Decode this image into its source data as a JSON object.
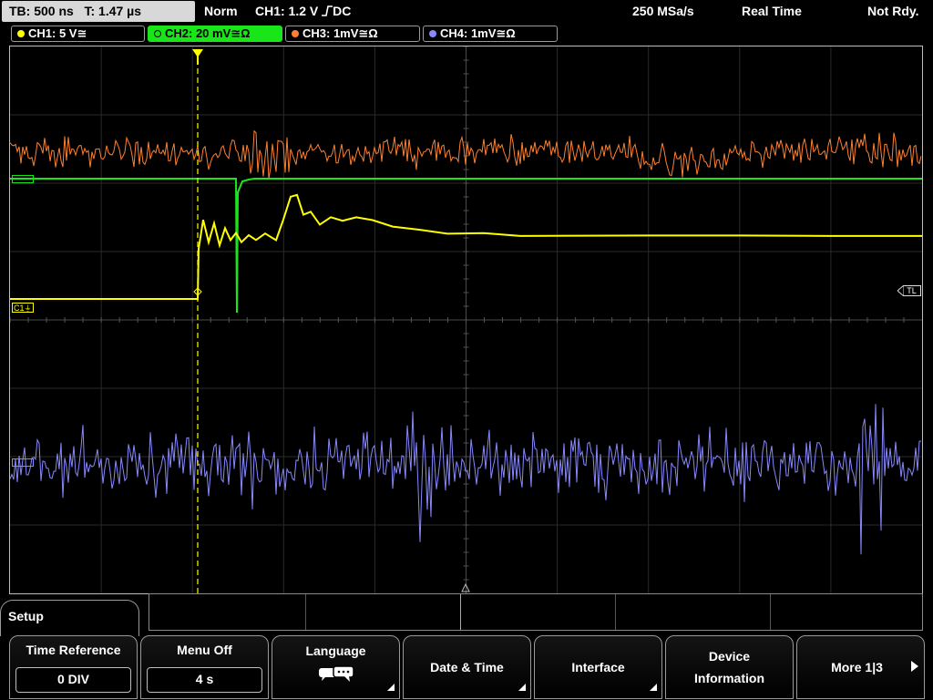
{
  "topbar": {
    "timebase": "TB: 500 ns",
    "trigger_time": "T: 1.47 µs",
    "trigger_mode": "Norm",
    "trigger_source": "CH1: 1.2 V",
    "trigger_coupling": "DC",
    "sample_rate": "250 MSa/s",
    "acq_mode": "Real Time",
    "status": "Not Rdy."
  },
  "channels": [
    {
      "label": "CH1: 5 V≅",
      "color": "#ffff00"
    },
    {
      "label": "CH2: 20 mV≅Ω",
      "color": "#19e619"
    },
    {
      "label": "CH3: 1mV≅Ω",
      "color": "#ff8030"
    },
    {
      "label": "CH4: 1mV≅Ω",
      "color": "#8888ff"
    }
  ],
  "markers": {
    "c1": "C1",
    "tl": "TL"
  },
  "menu": {
    "title": "Setup",
    "softkeys": [
      {
        "label": "Time Reference",
        "value": "0 DIV"
      },
      {
        "label": "Menu Off",
        "value": "4 s"
      },
      {
        "label": "Language",
        "icon": "speech-bubbles-icon"
      },
      {
        "label": "Date & Time"
      },
      {
        "label": "Interface"
      },
      {
        "label": "Device",
        "label2": "Information"
      },
      {
        "label": "More 1|3"
      }
    ]
  }
}
